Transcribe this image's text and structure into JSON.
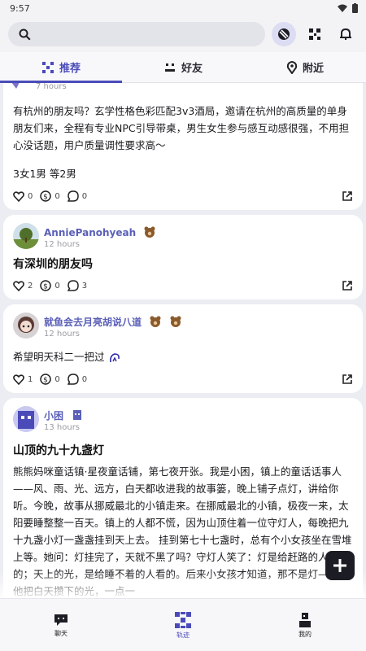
{
  "status_bar": {
    "time": "9:57"
  },
  "search": {
    "placeholder": ""
  },
  "tabs": [
    {
      "label": "推荐",
      "active": true
    },
    {
      "label": "好友",
      "active": false
    },
    {
      "label": "附近",
      "active": false
    }
  ],
  "posts": [
    {
      "time": "7 hours",
      "body": "有杭州的朋友吗？玄学性格色彩匹配3v3酒局，邀请在杭州的高质量的单身朋友们来，全程有专业NPC引导带桌，男生女生参与感互动感很强，不用担心没话题，用户质量调性要求高～",
      "extra": "3女1男 等2男",
      "likes": "0",
      "coins": "0",
      "comments": "0"
    },
    {
      "name": "AnniePanohyeah",
      "time": "12 hours",
      "title": "有深圳的朋友吗",
      "likes": "2",
      "coins": "0",
      "comments": "3"
    },
    {
      "name": "就鱼会去月亮胡说八道",
      "time": "12 hours",
      "body": "希望明天科二一把过",
      "likes": "1",
      "coins": "0",
      "comments": "0"
    },
    {
      "name": "小困",
      "time": "13 hours",
      "title": "山顶的九十九盏灯",
      "body": "熊熊妈咪童话镇·星夜童话铺，第七夜开张。我是小困，镇上的童话话事人——风、雨、光、远方，白天都收进我的故事篓，晚上铺子点灯，讲给你听。今晚，故事从挪威最北的小镇走来。在挪威最北的小镇，极夜一来，太阳要睡整整一百天。镇上的人都不慌，因为山顶住着一位守灯人，每晚把九十九盏小灯一盏盏挂到天上去。 挂到第七十七盏时，总有个小女孩坐在雪堆上等。她问：灯挂完了，天就不黑了吗？守灯人笑了：灯是给赶路的人看的；天上的光，是给睡不着的人看的。后来小女孩才知道，那不是灯——是他把白天攒下的光，一点一"
    }
  ],
  "bottom_nav": [
    {
      "label": "聊天"
    },
    {
      "label": "轨迹"
    },
    {
      "label": "我的"
    }
  ],
  "colors": {
    "accent": "#4a4bb8",
    "name": "#5a5fb7"
  }
}
